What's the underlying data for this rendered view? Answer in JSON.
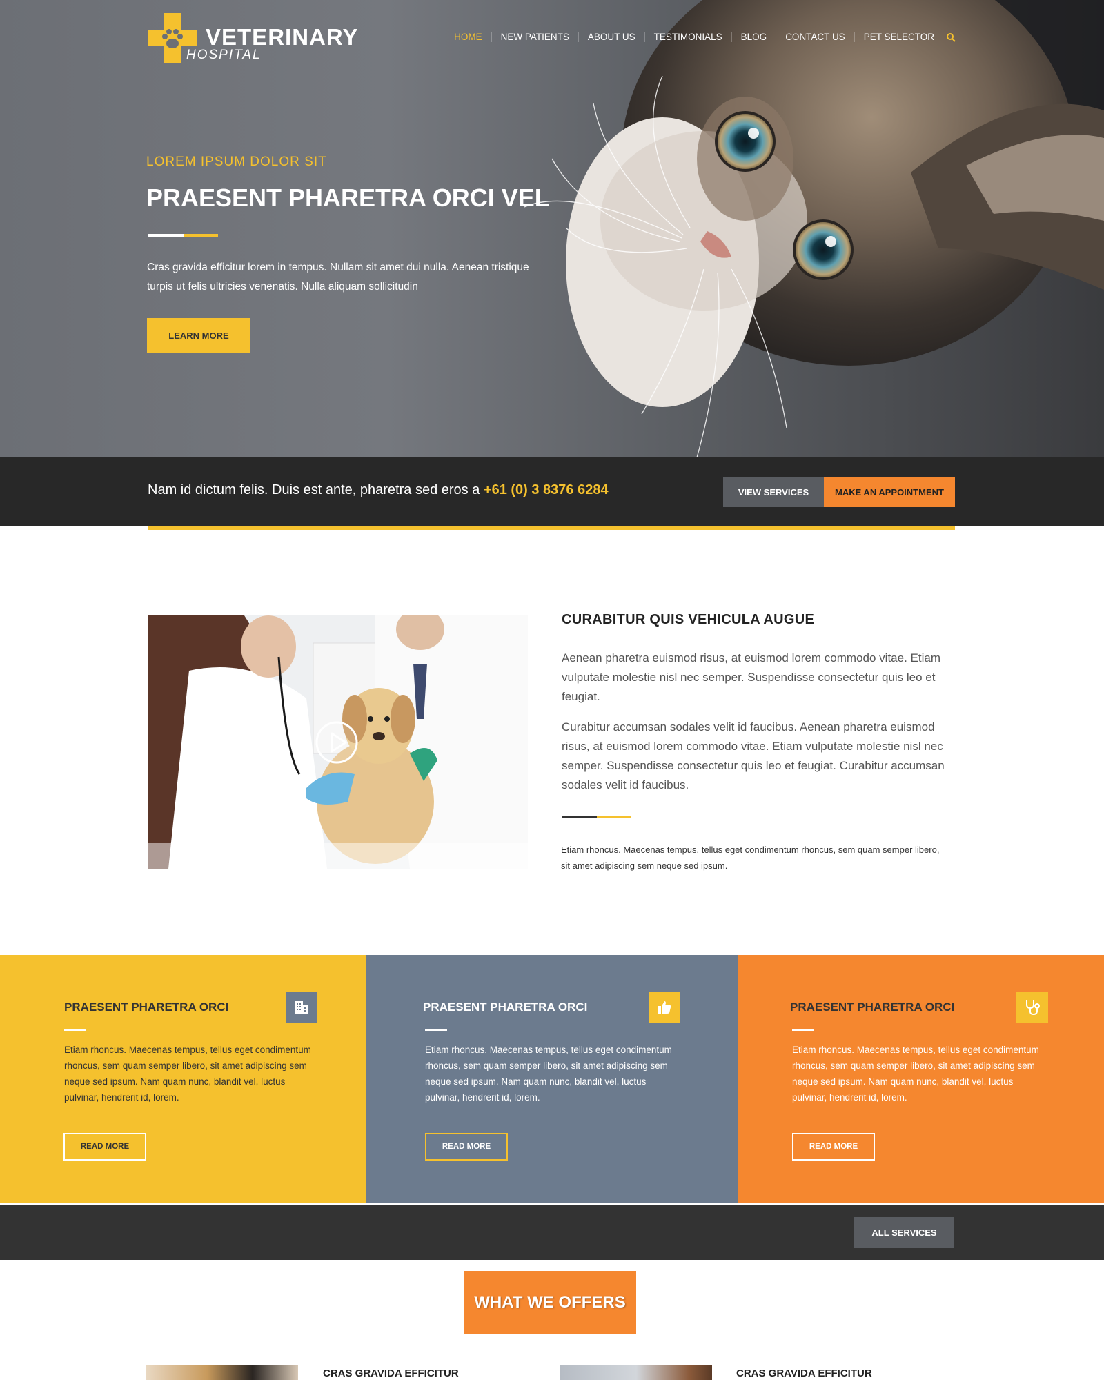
{
  "brand": {
    "title": "VETERINARY",
    "subtitle": "HOSPITAL"
  },
  "nav": {
    "items": [
      "HOME",
      "NEW PATIENTS",
      "ABOUT US",
      "TESTIMONIALS",
      "BLOG",
      "CONTACT US",
      "PET SELECTOR"
    ],
    "active": "HOME",
    "search_icon": "search-icon"
  },
  "hero": {
    "eyebrow": "LOREM IPSUM DOLOR SIT",
    "title": "PRAESENT PHARETRA ORCI VEL",
    "text": "Cras gravida efficitur lorem in tempus. Nullam sit amet dui nulla. Aenean tristique turpis ut felis ultricies venenatis. Nulla aliquam sollicitudin",
    "button": "LEARN MORE"
  },
  "cta": {
    "text": "Nam id dictum felis. Duis est ante, pharetra sed eros a",
    "phone": "+61 (0) 3 8376 6284",
    "view_services": "VIEW SERVICES",
    "appointment": "MAKE AN APPOINTMENT"
  },
  "about": {
    "heading": "CURABITUR QUIS VEHICULA AUGUE",
    "paragraph1": "Aenean pharetra euismod risus, at euismod lorem commodo vitae. Etiam vulputate molestie nisl nec semper. Suspendisse consectetur quis leo et feugiat.",
    "paragraph2": "Curabitur accumsan sodales velit id faucibus. Aenean pharetra euismod risus, at euismod lorem commodo vitae. Etiam vulputate molestie nisl nec semper. Suspendisse consectetur quis leo et feugiat. Curabitur accumsan sodales velit id faucibus.",
    "small": "Etiam rhoncus. Maecenas tempus, tellus eget condimentum rhoncus, sem quam semper libero, sit amet adipiscing sem neque sed ipsum."
  },
  "features": [
    {
      "title": "PRAESENT PHARETRA ORCI",
      "text": "Etiam rhoncus. Maecenas tempus, tellus eget condimentum rhoncus, sem quam semper libero, sit amet adipiscing sem neque sed ipsum. Nam quam nunc, blandit vel, luctus pulvinar, hendrerit id, lorem.",
      "button": "READ MORE",
      "icon": "building-icon"
    },
    {
      "title": "PRAESENT PHARETRA ORCI",
      "text": "Etiam rhoncus. Maecenas tempus, tellus eget condimentum rhoncus, sem quam semper libero, sit amet adipiscing sem neque sed ipsum. Nam quam nunc, blandit vel, luctus pulvinar, hendrerit id, lorem.",
      "button": "READ MORE",
      "icon": "thumbs-up-icon"
    },
    {
      "title": "PRAESENT PHARETRA ORCI",
      "text": "Etiam rhoncus. Maecenas tempus, tellus eget condimentum rhoncus, sem quam semper libero, sit amet adipiscing sem neque sed ipsum. Nam quam nunc, blandit vel, luctus pulvinar, hendrerit id, lorem.",
      "button": "READ MORE",
      "icon": "stethoscope-icon"
    }
  ],
  "services_bar": {
    "button": "ALL SERVICES"
  },
  "offers": {
    "heading": "WHAT WE OFFERS",
    "items": [
      {
        "title": "CRAS GRAVIDA EFFICITUR"
      },
      {
        "title": "CRAS GRAVIDA EFFICITUR"
      }
    ]
  },
  "colors": {
    "yellow": "#f5c12e",
    "orange": "#f5872f",
    "slate": "#6c7b8e",
    "dark": "#282828"
  }
}
